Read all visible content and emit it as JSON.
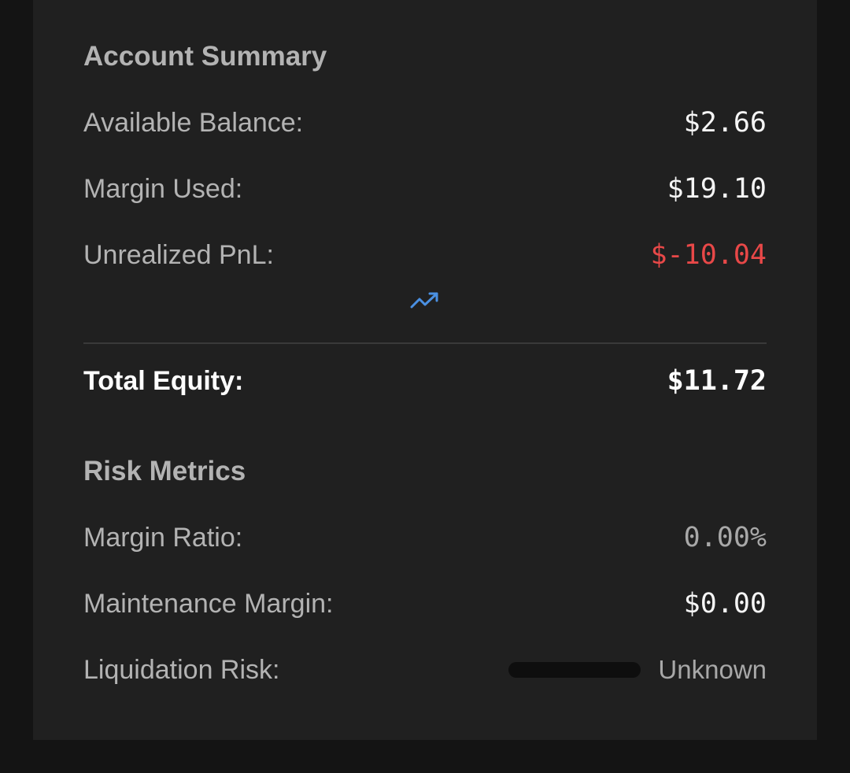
{
  "account_summary": {
    "title": "Account Summary",
    "available_balance": {
      "label": "Available Balance:",
      "value": "$2.66"
    },
    "margin_used": {
      "label": "Margin Used:",
      "value": "$19.10"
    },
    "unrealized_pnl": {
      "label": "Unrealized PnL:",
      "value": "$-10.04",
      "color": "#e84848"
    },
    "trend_icon": "trending-up-icon",
    "total_equity": {
      "label": "Total Equity:",
      "value": "$11.72"
    }
  },
  "risk_metrics": {
    "title": "Risk Metrics",
    "margin_ratio": {
      "label": "Margin Ratio:",
      "value": "0.00%"
    },
    "maintenance_margin": {
      "label": "Maintenance Margin:",
      "value": "$0.00"
    },
    "liquidation_risk": {
      "label": "Liquidation Risk:",
      "status": "Unknown",
      "level": 0
    }
  },
  "colors": {
    "background": "#141414",
    "panel": "#202020",
    "negative": "#e84848",
    "accent": "#4a90e2"
  }
}
